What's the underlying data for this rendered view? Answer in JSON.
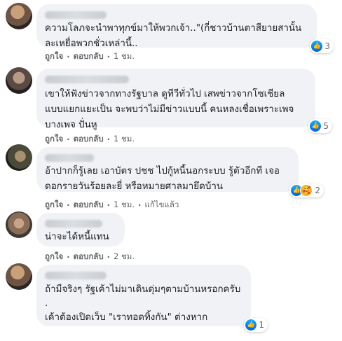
{
  "comments": [
    {
      "text": "ความโลภจะนำพาทุกข์มาให้พวกเจ้า..\"(กี่ชาวบ้านตาสียายสานั้น\nละเหยื่อพวกชั่วเหล่านี้..",
      "reaction_count": "3",
      "actions": {
        "like": "ถูกใจ",
        "reply": "ตอบกลับ",
        "time": "1 ชม."
      }
    },
    {
      "text": "เขาให้ฟังข่าวจากทางรัฐบาล ดูทีวีทั่วไป เสพข่าวจากโซเชียล\nแบบแยกแยะเป็น จะพบว่าไม่มีข่าวแบบนี้ คนหลงเชื่อเพราะเพจ\nบางเพจ ปั่นหู",
      "reaction_count": "5",
      "actions": {
        "like": "ถูกใจ",
        "reply": "ตอบกลับ",
        "time": "1 ชม."
      }
    },
    {
      "text": "อ้าปากก็รู้เลย เอาบัตร ปชช ไปกู้หนี้นอกระบบ รู้ตัวอีกที เจอ\nดอกรายวันร้อยละยี่ หรือหมายศาลมายึดบ้าน",
      "reaction_count": "2",
      "actions": {
        "like": "ถูกใจ",
        "reply": "ตอบกลับ",
        "time": "1 ชม.",
        "edited": "แก้ไขแล้ว"
      }
    },
    {
      "text": "น่าจะได้หนี้แทน",
      "actions": {
        "like": "ถูกใจ",
        "reply": "ตอบกลับ",
        "time": "2 ชม."
      }
    },
    {
      "text": "ถ้ามีจริงๆ รัฐเค้าไม่มาเดินดุ่มๆตามบ้านหรอกครับ\n.\nเค้าต้องเปิดเว็บ \"เราทอดทิ้งกัน\" ต่างหาก",
      "reaction_count": "1"
    }
  ],
  "icons": {
    "like": "like-reaction-icon",
    "care": "care-reaction-icon"
  },
  "colors": {
    "bubble": "#f0f2f5",
    "meta": "#65676b",
    "like_blue": "#1877f2"
  }
}
